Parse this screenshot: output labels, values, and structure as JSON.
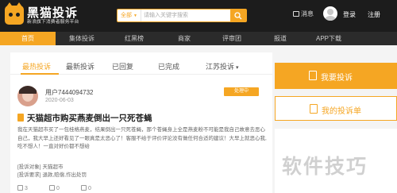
{
  "header": {
    "logo_title": "黑猫投诉",
    "logo_subtitle": "新浪旗下消费者服务平台",
    "search": {
      "scope": "全部",
      "placeholder": "请输入关键字搜索"
    },
    "messages_label": "消息",
    "login_label": "登录",
    "register_label": "注册"
  },
  "nav": {
    "items": [
      "首页",
      "集体投诉",
      "红黑榜",
      "商家",
      "评审团",
      "报道",
      "APP下载"
    ],
    "active": "首页"
  },
  "tabs": {
    "items": [
      "最热投诉",
      "最新投诉",
      "已回复",
      "已完成",
      "江苏投诉"
    ],
    "active": "最热投诉",
    "location_chevron": "▾"
  },
  "post": {
    "user_name": "用户7444094732",
    "date": "2020-06-03",
    "status": "处理中",
    "title": "天猫超市购买燕麦倒出一只死苍蝇",
    "body": "我在天猫超市买了一包桂格燕麦，结果倒出一只死苍蝇，那个苍蝇身上全是燕麦粉不可能是我自己故意去恶心自己，我大早上还好看见了一眼真是太恶心了！客服不给于评价评论没有做任何合适的建议！大早上就恶心我,吃不想人！一直对好价都不想给",
    "target_label": "[投诉对象]",
    "target_value": "天猫超市",
    "request_label": "[投诉要求]",
    "request_value": "退款,赔偿,作出处罚",
    "likes": "3",
    "comments": "0",
    "shares": "0"
  },
  "sidebar": {
    "complain_button": "我要投诉",
    "my_complaints_button": "我的投诉单"
  },
  "watermark": "软件技巧",
  "colors": {
    "accent": "#f5a623",
    "header_bg": "#1c1c1c",
    "nav_bg": "#2b2b2b"
  }
}
